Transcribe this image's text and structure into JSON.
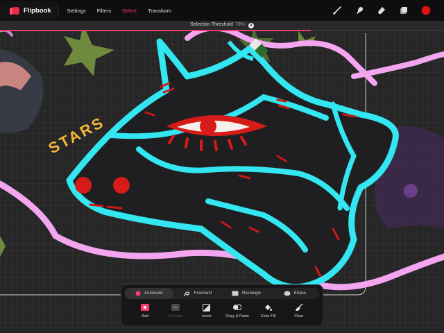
{
  "app": {
    "name": "Flipbook",
    "menu": [
      {
        "label": "Settings",
        "active": false
      },
      {
        "label": "Filters",
        "active": false
      },
      {
        "label": "Select",
        "active": true
      },
      {
        "label": "Transform",
        "active": false
      }
    ],
    "tools": [
      "brush-icon",
      "smudge-icon",
      "eraser-icon",
      "layers-icon",
      "color-icon"
    ],
    "current_color": "#e01414",
    "accent": "#ff3b6b"
  },
  "threshold": {
    "label": "Selection Threshold",
    "value": "70%",
    "fraction": 0.7,
    "close_icon": "close-icon"
  },
  "canvas": {
    "text": "STARS"
  },
  "selection": {
    "modes": [
      {
        "label": "Automatic",
        "icon": "automatic-icon",
        "active": true
      },
      {
        "label": "Freehand",
        "icon": "freehand-icon",
        "active": false
      },
      {
        "label": "Rectangle",
        "icon": "rectangle-icon",
        "active": false
      },
      {
        "label": "Ellipse",
        "icon": "ellipse-icon",
        "active": false
      }
    ],
    "actions": [
      {
        "label": "Add",
        "icon": "add-icon",
        "enabled": true
      },
      {
        "label": "Remove",
        "icon": "remove-icon",
        "enabled": false
      },
      {
        "label": "Invert",
        "icon": "invert-icon",
        "enabled": true
      },
      {
        "label": "Copy & Paste",
        "icon": "copy-paste-icon",
        "enabled": true
      },
      {
        "label": "Color Fill",
        "icon": "color-fill-icon",
        "enabled": true
      },
      {
        "label": "Clear",
        "icon": "clear-icon",
        "enabled": true
      }
    ]
  }
}
